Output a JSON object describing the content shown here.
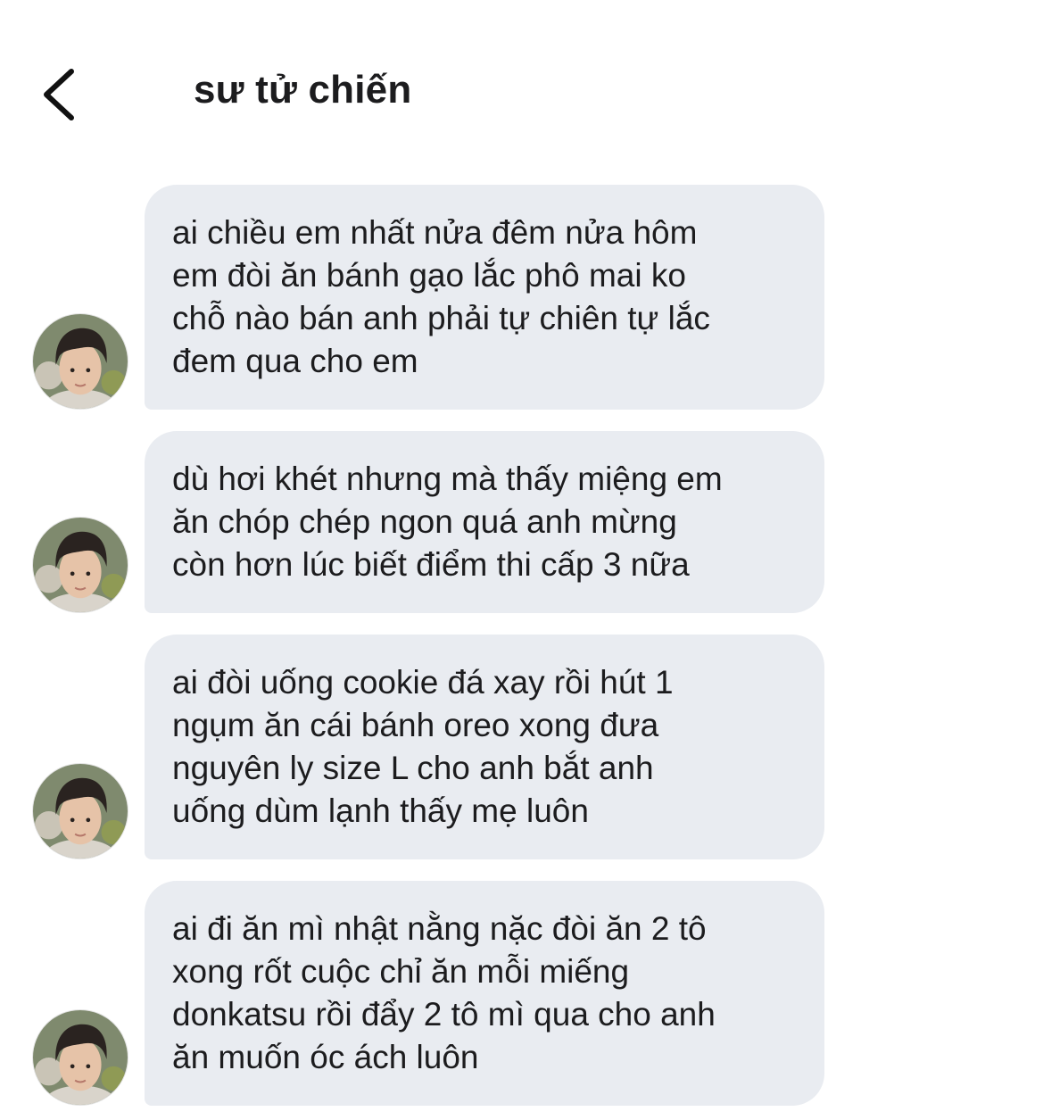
{
  "header": {
    "title": "sư tử chiến",
    "back_icon": "chevron-left-icon"
  },
  "messages": [
    {
      "text": "ai chiều em nhất nửa đêm nửa hôm\nem đòi ăn bánh gạo lắc phô mai ko\nchỗ nào bán anh phải tự chiên tự lắc\nđem qua cho em",
      "avatar": "avatar-photo"
    },
    {
      "text": "dù hơi khét nhưng mà thấy miệng em\năn chóp chép ngon quá anh mừng\ncòn hơn lúc biết điểm thi cấp 3 nữa",
      "avatar": "avatar-photo"
    },
    {
      "text": "ai đòi uống cookie đá xay rồi hút 1\nngụm ăn cái bánh oreo xong đưa\nnguyên ly size L cho anh bắt anh\nuống dùm lạnh thấy mẹ luôn",
      "avatar": "avatar-photo"
    },
    {
      "text": "ai đi ăn mì nhật nằng nặc đòi ăn 2 tô\nxong rốt cuộc chỉ ăn mỗi miếng\ndonkatsu rồi đẩy 2 tô mì qua cho anh\năn muốn óc ách luôn",
      "avatar": "avatar-photo"
    }
  ],
  "colors": {
    "bubble_bg": "#e9ecf1",
    "text": "#1c1c1e",
    "background": "#ffffff"
  }
}
